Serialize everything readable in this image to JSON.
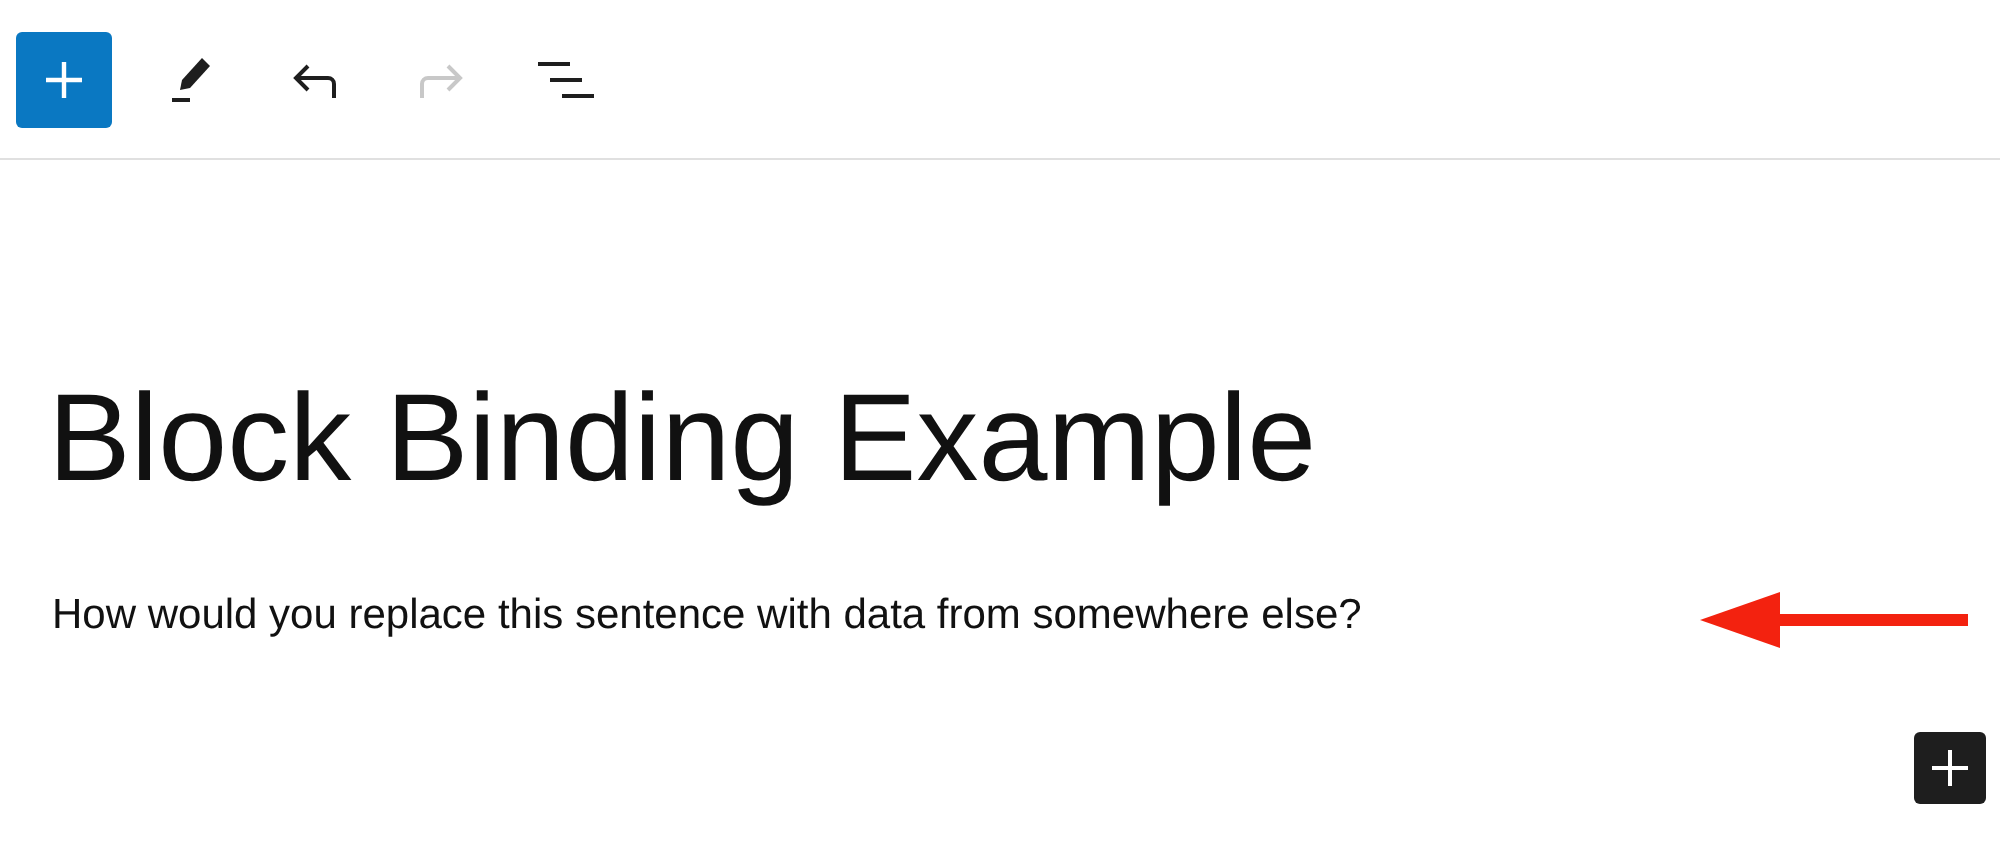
{
  "toolbar": {
    "undo": {
      "disabled": false
    },
    "redo": {
      "disabled": true
    }
  },
  "title": "Block Binding Example",
  "paragraph": "How would you replace this sentence with data from somewhere else?"
}
